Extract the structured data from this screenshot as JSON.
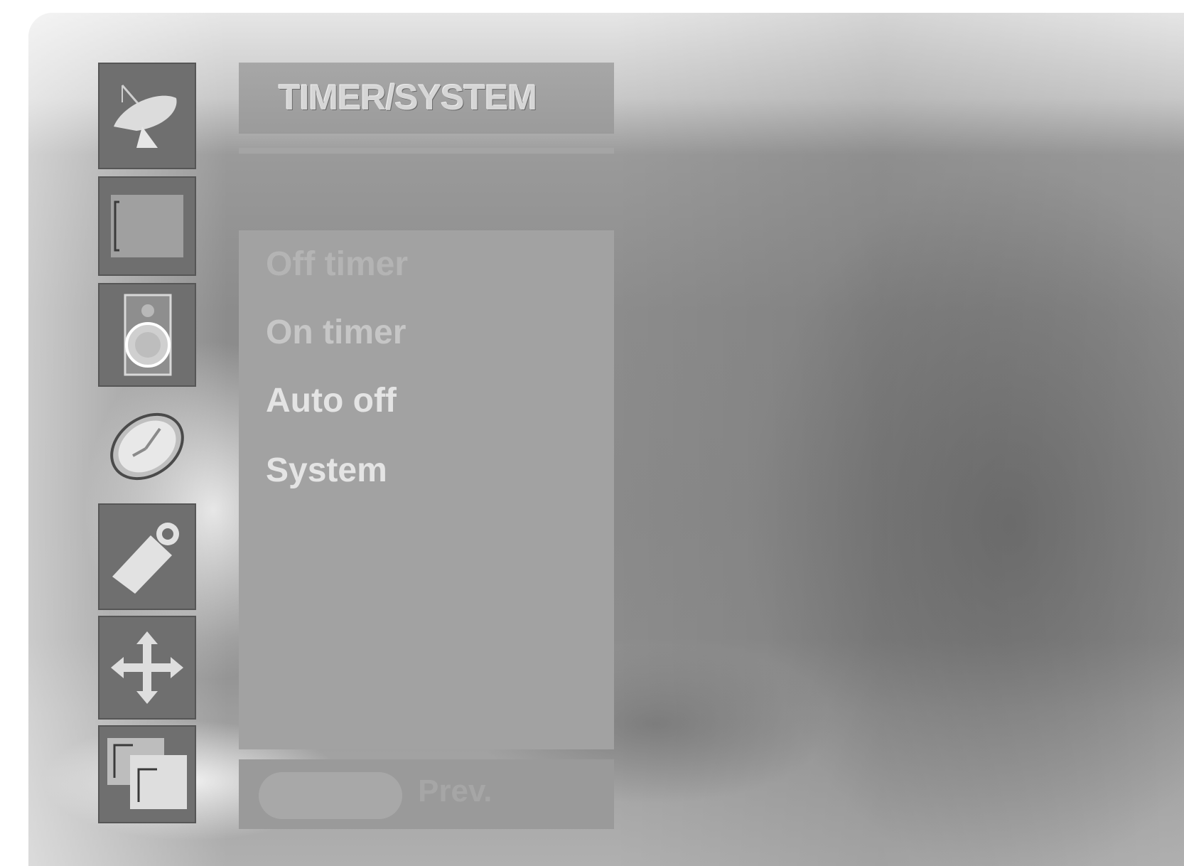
{
  "sidebar": {
    "icons": [
      {
        "name": "satellite-dish-icon",
        "selected": false
      },
      {
        "name": "picture-icon",
        "selected": false
      },
      {
        "name": "speaker-icon",
        "selected": false
      },
      {
        "name": "clock-icon",
        "selected": true
      },
      {
        "name": "tag-icon",
        "selected": false
      },
      {
        "name": "arrows-icon",
        "selected": false
      },
      {
        "name": "pip-icon",
        "selected": false
      }
    ]
  },
  "menu": {
    "title": "TIMER/SYSTEM",
    "items": [
      {
        "label": "Off timer"
      },
      {
        "label": "On timer"
      },
      {
        "label": "Auto off"
      },
      {
        "label": "System"
      }
    ]
  },
  "footer": {
    "prev_label": "Prev."
  }
}
